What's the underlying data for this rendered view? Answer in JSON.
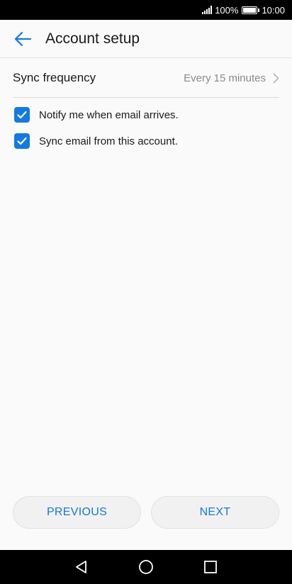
{
  "status_bar": {
    "battery_percent": "100%",
    "time": "10:00"
  },
  "header": {
    "title": "Account setup",
    "back_icon": "arrow-left-icon"
  },
  "sync_row": {
    "label": "Sync frequency",
    "value": "Every 15 minutes",
    "chevron_icon": "chevron-right-icon"
  },
  "options": [
    {
      "label": "Notify me when email arrives.",
      "checked": true
    },
    {
      "label": "Sync email from this account.",
      "checked": true
    }
  ],
  "buttons": {
    "previous": "PREVIOUS",
    "next": "NEXT"
  },
  "colors": {
    "accent": "#1479e0",
    "background": "#fafafa",
    "bars": "#000000"
  },
  "nav_bar": {
    "back_icon": "triangle-back-icon",
    "home_icon": "circle-home-icon",
    "recents_icon": "square-recents-icon"
  }
}
